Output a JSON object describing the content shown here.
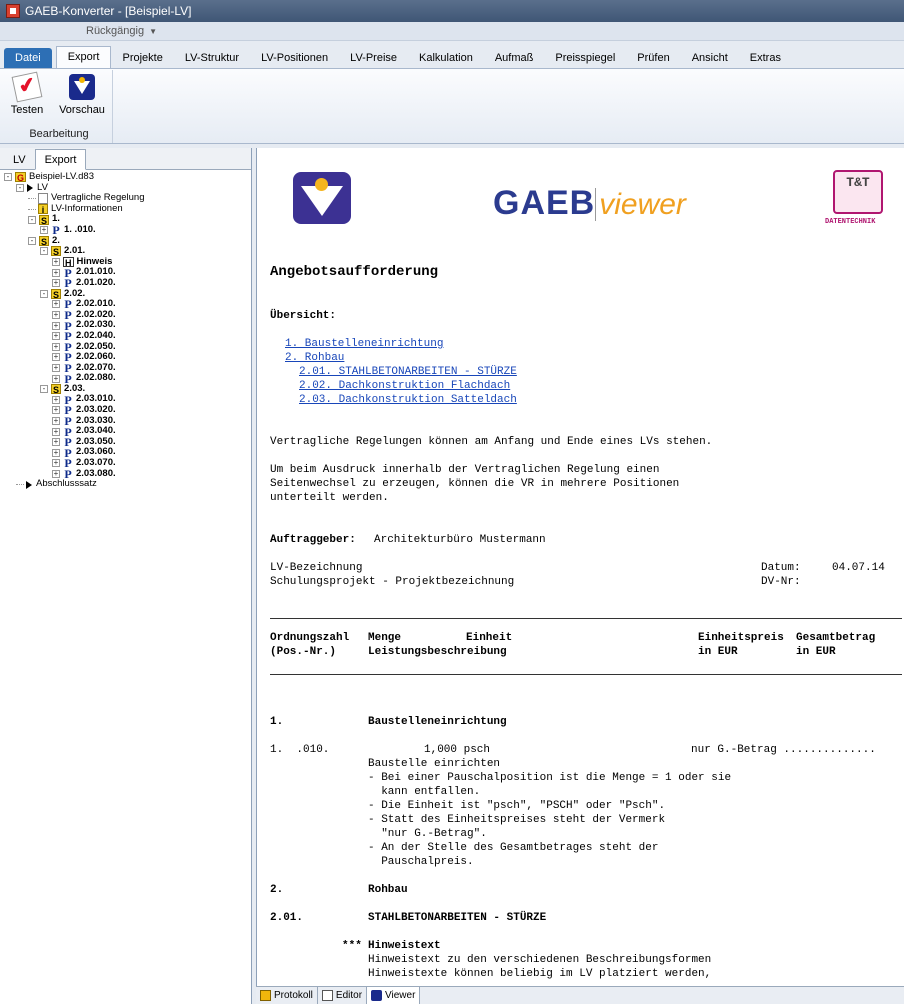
{
  "window": {
    "title": "GAEB-Konverter - [Beispiel-LV]",
    "qat_undo": "Rückgängig"
  },
  "ribbon": {
    "tabs": [
      "Datei",
      "Export",
      "Projekte",
      "LV-Struktur",
      "LV-Positionen",
      "LV-Preise",
      "Kalkulation",
      "Aufmaß",
      "Preisspiegel",
      "Prüfen",
      "Ansicht",
      "Extras"
    ],
    "active_tab": "Export",
    "group_label": "Bearbeitung",
    "buttons": {
      "test": "Testen",
      "preview": "Vorschau"
    }
  },
  "left_panel": {
    "tabs": [
      "LV",
      "Export"
    ],
    "tree": [
      {
        "indent": 0,
        "exp": "−",
        "badge": "G",
        "label": "Beispiel-LV.d83"
      },
      {
        "indent": 1,
        "exp": "−",
        "badge": "tri",
        "label": "LV"
      },
      {
        "indent": 2,
        "exp": "",
        "badge": "doc",
        "label": "Vertragliche Regelung"
      },
      {
        "indent": 2,
        "exp": "",
        "badge": "i",
        "label": "LV-Informationen"
      },
      {
        "indent": 2,
        "exp": "−",
        "badge": "S",
        "label": "1."
      },
      {
        "indent": 3,
        "exp": "+",
        "badge": "P",
        "label": "1.  .010."
      },
      {
        "indent": 2,
        "exp": "−",
        "badge": "S",
        "label": "2."
      },
      {
        "indent": 3,
        "exp": "−",
        "badge": "S",
        "label": "2.01."
      },
      {
        "indent": 4,
        "exp": "+",
        "badge": "H",
        "label": "Hinweis"
      },
      {
        "indent": 4,
        "exp": "+",
        "badge": "P",
        "label": "2.01.010."
      },
      {
        "indent": 4,
        "exp": "+",
        "badge": "P",
        "label": "2.01.020."
      },
      {
        "indent": 3,
        "exp": "−",
        "badge": "S",
        "label": "2.02."
      },
      {
        "indent": 4,
        "exp": "+",
        "badge": "P",
        "label": "2.02.010."
      },
      {
        "indent": 4,
        "exp": "+",
        "badge": "P",
        "label": "2.02.020."
      },
      {
        "indent": 4,
        "exp": "+",
        "badge": "P",
        "label": "2.02.030."
      },
      {
        "indent": 4,
        "exp": "+",
        "badge": "P",
        "label": "2.02.040."
      },
      {
        "indent": 4,
        "exp": "+",
        "badge": "P",
        "label": "2.02.050."
      },
      {
        "indent": 4,
        "exp": "+",
        "badge": "P",
        "label": "2.02.060."
      },
      {
        "indent": 4,
        "exp": "+",
        "badge": "P",
        "label": "2.02.070."
      },
      {
        "indent": 4,
        "exp": "+",
        "badge": "P",
        "label": "2.02.080."
      },
      {
        "indent": 3,
        "exp": "−",
        "badge": "S",
        "label": "2.03."
      },
      {
        "indent": 4,
        "exp": "+",
        "badge": "P",
        "label": "2.03.010."
      },
      {
        "indent": 4,
        "exp": "+",
        "badge": "P",
        "label": "2.03.020."
      },
      {
        "indent": 4,
        "exp": "+",
        "badge": "P",
        "label": "2.03.030."
      },
      {
        "indent": 4,
        "exp": "+",
        "badge": "P",
        "label": "2.03.040."
      },
      {
        "indent": 4,
        "exp": "+",
        "badge": "P",
        "label": "2.03.050."
      },
      {
        "indent": 4,
        "exp": "+",
        "badge": "P",
        "label": "2.03.060."
      },
      {
        "indent": 4,
        "exp": "+",
        "badge": "P",
        "label": "2.03.070."
      },
      {
        "indent": 4,
        "exp": "+",
        "badge": "P",
        "label": "2.03.080."
      },
      {
        "indent": 1,
        "exp": "",
        "badge": "tri",
        "label": "Abschlusssatz"
      }
    ]
  },
  "viewer": {
    "logo_gaeb_bold": "GAEB",
    "logo_gaeb_light": "viewer",
    "logo_tt": "T&T",
    "logo_tt_sub": "DATENTECHNIK",
    "heading": "Angebotsaufforderung",
    "overview_label": "Übersicht:",
    "toc": [
      "1. Baustelleneinrichtung",
      "2. Rohbau",
      "2.01. STAHLBETONARBEITEN - STÜRZE",
      "2.02. Dachkonstruktion Flachdach",
      "2.03. Dachkonstruktion Satteldach"
    ],
    "vr_line1": "Vertragliche Regelungen können am Anfang und Ende eines LVs stehen.",
    "vr_para": [
      "Um beim Ausdruck innerhalb der Vertraglichen Regelung einen",
      "Seitenwechsel zu erzeugen, können die VR in mehrere Positionen",
      "unterteilt werden."
    ],
    "client_label": "Auftraggeber:",
    "client_value": "Architekturbüro Mustermann",
    "lv_label": "LV-Bezeichnung",
    "lv_value": "Schulungsprojekt - Projektbezeichnung",
    "date_label": "Datum:",
    "date_value": "04.07.14",
    "dv_label": "DV-Nr:",
    "table_header": {
      "col1a": "Ordnungszahl",
      "col1b": "(Pos.-Nr.)",
      "col2a": "Menge",
      "col2b": "Leistungsbeschreibung",
      "col3a": "Einheit",
      "col4a": "Einheitspreis",
      "col4b": "in EUR",
      "col5a": "Gesamtbetrag",
      "col5b": "in EUR"
    },
    "sec1_num": "1.",
    "sec1_title": "Baustelleneinrichtung",
    "pos_num": "1.  .010.",
    "pos_qty": "1,000 psch",
    "pos_price": "nur G.-Betrag ..............",
    "pos_lines": [
      "Baustelle einrichten",
      "- Bei einer Pauschalposition ist die Menge = 1 oder sie",
      "  kann entfallen.",
      "- Die Einheit ist \"psch\", \"PSCH\" oder \"Psch\".",
      "- Statt des Einheitspreises steht der Vermerk",
      "  \"nur G.-Betrag\".",
      "- An der Stelle des Gesamtbetrages steht der",
      "  Pauschalpreis."
    ],
    "sec2_num": "2.",
    "sec2_title": "Rohbau",
    "sec201_num": "2.01.",
    "sec201_title": "STAHLBETONARBEITEN - STÜRZE",
    "hint_stars": "***",
    "hint_title": "Hinweistext",
    "hint_lines": [
      "Hinweistext zu den verschiedenen Beschreibungsformen",
      "Hinweistexte können beliebig im LV platziert werden,"
    ]
  },
  "bottom_tabs": [
    "Protokoll",
    "Editor",
    "Viewer"
  ],
  "colors": {
    "link": "#1846b9",
    "ribbon_file": "#2d6fb5",
    "logo_v": "#3c3193",
    "tt": "#b01670"
  }
}
